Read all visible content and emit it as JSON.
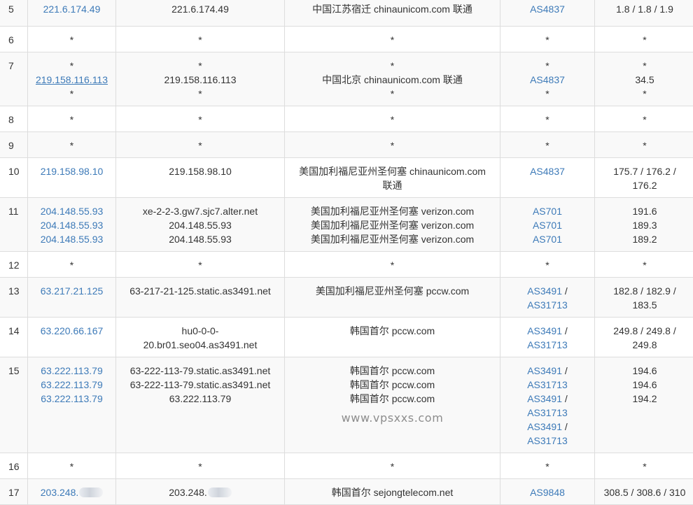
{
  "rows": [
    {
      "hop": "5",
      "ips": [
        "221.6.174.49"
      ],
      "hosts": [
        "221.6.174.49"
      ],
      "locs": [
        "中国江苏宿迁 chinaunicom.com 联通"
      ],
      "asns": [
        {
          "a": "AS4837"
        }
      ],
      "times": [
        "1.8 / 1.8 / 1.9"
      ]
    },
    {
      "hop": "6",
      "ips": [
        "*"
      ],
      "hosts": [
        "*"
      ],
      "locs": [
        "*"
      ],
      "asns": [
        {
          "a": "*"
        }
      ],
      "times": [
        "*"
      ]
    },
    {
      "hop": "7",
      "ips": [
        "*",
        "219.158.116.113",
        "*"
      ],
      "hosts": [
        "*",
        "219.158.116.113",
        "*"
      ],
      "locs": [
        "*",
        "中国北京 chinaunicom.com 联通",
        "*"
      ],
      "asns": [
        {
          "a": "*"
        },
        {
          "a": "AS4837"
        },
        {
          "a": "*"
        }
      ],
      "times": [
        "*",
        "34.5",
        "*"
      ]
    },
    {
      "hop": "8",
      "ips": [
        "*"
      ],
      "hosts": [
        "*"
      ],
      "locs": [
        "*"
      ],
      "asns": [
        {
          "a": "*"
        }
      ],
      "times": [
        "*"
      ]
    },
    {
      "hop": "9",
      "ips": [
        "*"
      ],
      "hosts": [
        "*"
      ],
      "locs": [
        "*"
      ],
      "asns": [
        {
          "a": "*"
        }
      ],
      "times": [
        "*"
      ]
    },
    {
      "hop": "10",
      "ips": [
        "219.158.98.10"
      ],
      "hosts": [
        "219.158.98.10"
      ],
      "locs": [
        "美国加利福尼亚州圣何塞 chinaunicom.com",
        "联通"
      ],
      "asns": [
        {
          "a": "AS4837"
        }
      ],
      "times": [
        "175.7 / 176.2 /",
        "176.2"
      ]
    },
    {
      "hop": "11",
      "ips": [
        "204.148.55.93",
        "204.148.55.93",
        "204.148.55.93"
      ],
      "hosts": [
        "xe-2-2-3.gw7.sjc7.alter.net",
        "204.148.55.93",
        "204.148.55.93"
      ],
      "locs": [
        "美国加利福尼亚州圣何塞 verizon.com",
        "美国加利福尼亚州圣何塞 verizon.com",
        "美国加利福尼亚州圣何塞 verizon.com"
      ],
      "asns": [
        {
          "a": "AS701"
        },
        {
          "a": "AS701"
        },
        {
          "a": "AS701"
        }
      ],
      "times": [
        "191.6",
        "189.3",
        "189.2"
      ]
    },
    {
      "hop": "12",
      "ips": [
        "*"
      ],
      "hosts": [
        "*"
      ],
      "locs": [
        "*"
      ],
      "asns": [
        {
          "a": "*"
        }
      ],
      "times": [
        "*"
      ]
    },
    {
      "hop": "13",
      "ips": [
        "63.217.21.125"
      ],
      "hosts": [
        "63-217-21-125.static.as3491.net"
      ],
      "locs": [
        "美国加利福尼亚州圣何塞 pccw.com"
      ],
      "asns": [
        {
          "a": "AS3491",
          "s": " /"
        },
        {
          "a": "AS31713"
        }
      ],
      "times": [
        "182.8 / 182.9 /",
        "183.5"
      ]
    },
    {
      "hop": "14",
      "ips": [
        "63.220.66.167"
      ],
      "hosts": [
        "hu0-0-0-",
        "20.br01.seo04.as3491.net"
      ],
      "locs": [
        "韩国首尔 pccw.com"
      ],
      "asns": [
        {
          "a": "AS3491",
          "s": " /"
        },
        {
          "a": "AS31713"
        }
      ],
      "times": [
        "249.8 / 249.8 /",
        "249.8"
      ]
    },
    {
      "hop": "15",
      "ips": [
        "63.222.113.79",
        "63.222.113.79",
        "63.222.113.79"
      ],
      "hosts": [
        "63-222-113-79.static.as3491.net",
        "63-222-113-79.static.as3491.net",
        "63.222.113.79"
      ],
      "locs": [
        "韩国首尔 pccw.com",
        "韩国首尔 pccw.com",
        "韩国首尔 pccw.com"
      ],
      "asns": [
        {
          "a": "AS3491",
          "s": " /"
        },
        {
          "a": "AS31713"
        },
        {
          "a": "AS3491",
          "s": " /"
        },
        {
          "a": "AS31713"
        },
        {
          "a": "AS3491",
          "s": " /"
        },
        {
          "a": "AS31713"
        }
      ],
      "times": [
        "194.6",
        "194.6",
        "194.2"
      ],
      "watermark": "www.vpsxxs.com"
    },
    {
      "hop": "16",
      "ips": [
        "*"
      ],
      "hosts": [
        "*"
      ],
      "locs": [
        "*"
      ],
      "asns": [
        {
          "a": "*"
        }
      ],
      "times": [
        "*"
      ]
    },
    {
      "hop": "17",
      "ips": [
        "203.248."
      ],
      "ip_blurred": true,
      "hosts": [
        "203.248."
      ],
      "host_blurred": true,
      "locs": [
        "韩国首尔 sejongtelecom.net"
      ],
      "asns": [
        {
          "a": "AS9848"
        }
      ],
      "times": [
        "308.5 / 308.6 / 310"
      ]
    }
  ],
  "colors": {
    "link": "#3d7ab8",
    "row_odd": "#f9f9f9",
    "row_even": "#ffffff",
    "border": "#dddddd",
    "text": "#333333"
  }
}
